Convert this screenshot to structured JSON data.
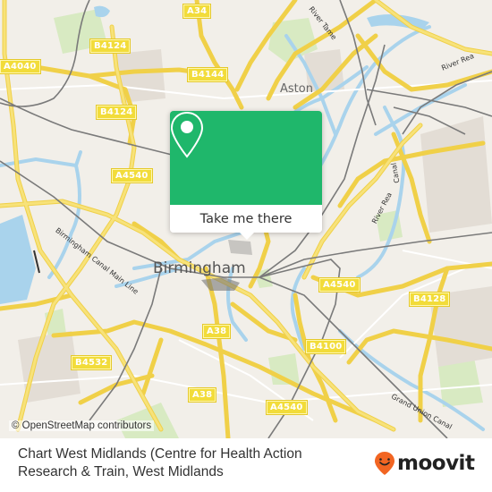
{
  "map": {
    "road_labels": [
      {
        "id": "a34",
        "text": "A34"
      },
      {
        "id": "b4124-top",
        "text": "B4124"
      },
      {
        "id": "a4040",
        "text": "A4040"
      },
      {
        "id": "b4144",
        "text": "B4144"
      },
      {
        "id": "b4124-mid",
        "text": "B4124"
      },
      {
        "id": "a4540-left",
        "text": "A4540"
      },
      {
        "id": "a4540-right",
        "text": "A4540"
      },
      {
        "id": "b4128",
        "text": "B4128"
      },
      {
        "id": "b4100",
        "text": "B4100"
      },
      {
        "id": "a38-top",
        "text": "A38"
      },
      {
        "id": "b4532",
        "text": "B4532"
      },
      {
        "id": "a38-bottom",
        "text": "A38"
      },
      {
        "id": "a4540-bottom",
        "text": "A4540"
      }
    ],
    "place_labels": {
      "city": "Birmingham",
      "suburb": "Aston"
    },
    "water_labels": {
      "river_tame": "River Tame",
      "river_rea_top": "River Rea",
      "river_rea_mid": "River Rea",
      "canal_main_line": "Birmingham Canal Main Line",
      "grand_union": "Grand Union Canal",
      "canal_right": "Canal"
    },
    "attribution": "© OpenStreetMap contributors",
    "colors": {
      "land": "#f2efe9",
      "road": "#f7dd5c",
      "water": "#a9d3ec",
      "park": "#d8eac2",
      "rail": "#777777"
    }
  },
  "popup": {
    "icon": "map-pin-icon",
    "button_label": "Take me there",
    "color": "#1fb76b"
  },
  "footer": {
    "title": "Chart West Midlands (Centre for Health Action Research & Train, West Midlands",
    "brand": {
      "name": "moovit",
      "icon": "moovit-smile-pin-icon",
      "accent": "#f26522"
    }
  }
}
